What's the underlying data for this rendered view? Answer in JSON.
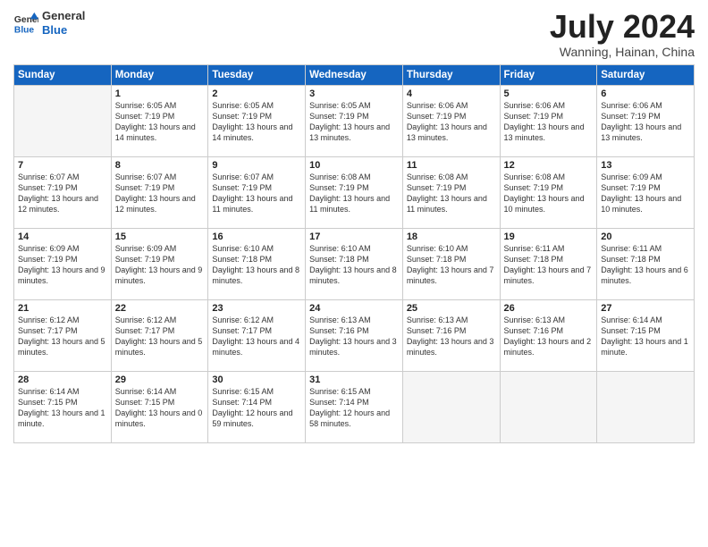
{
  "header": {
    "logo_general": "General",
    "logo_blue": "Blue",
    "month_title": "July 2024",
    "location": "Wanning, Hainan, China"
  },
  "days_of_week": [
    "Sunday",
    "Monday",
    "Tuesday",
    "Wednesday",
    "Thursday",
    "Friday",
    "Saturday"
  ],
  "weeks": [
    [
      {
        "num": "",
        "empty": true
      },
      {
        "num": "1",
        "sunrise": "6:05 AM",
        "sunset": "7:19 PM",
        "daylight": "13 hours and 14 minutes."
      },
      {
        "num": "2",
        "sunrise": "6:05 AM",
        "sunset": "7:19 PM",
        "daylight": "13 hours and 14 minutes."
      },
      {
        "num": "3",
        "sunrise": "6:05 AM",
        "sunset": "7:19 PM",
        "daylight": "13 hours and 13 minutes."
      },
      {
        "num": "4",
        "sunrise": "6:06 AM",
        "sunset": "7:19 PM",
        "daylight": "13 hours and 13 minutes."
      },
      {
        "num": "5",
        "sunrise": "6:06 AM",
        "sunset": "7:19 PM",
        "daylight": "13 hours and 13 minutes."
      },
      {
        "num": "6",
        "sunrise": "6:06 AM",
        "sunset": "7:19 PM",
        "daylight": "13 hours and 13 minutes."
      }
    ],
    [
      {
        "num": "7",
        "sunrise": "6:07 AM",
        "sunset": "7:19 PM",
        "daylight": "13 hours and 12 minutes."
      },
      {
        "num": "8",
        "sunrise": "6:07 AM",
        "sunset": "7:19 PM",
        "daylight": "13 hours and 12 minutes."
      },
      {
        "num": "9",
        "sunrise": "6:07 AM",
        "sunset": "7:19 PM",
        "daylight": "13 hours and 11 minutes."
      },
      {
        "num": "10",
        "sunrise": "6:08 AM",
        "sunset": "7:19 PM",
        "daylight": "13 hours and 11 minutes."
      },
      {
        "num": "11",
        "sunrise": "6:08 AM",
        "sunset": "7:19 PM",
        "daylight": "13 hours and 11 minutes."
      },
      {
        "num": "12",
        "sunrise": "6:08 AM",
        "sunset": "7:19 PM",
        "daylight": "13 hours and 10 minutes."
      },
      {
        "num": "13",
        "sunrise": "6:09 AM",
        "sunset": "7:19 PM",
        "daylight": "13 hours and 10 minutes."
      }
    ],
    [
      {
        "num": "14",
        "sunrise": "6:09 AM",
        "sunset": "7:19 PM",
        "daylight": "13 hours and 9 minutes."
      },
      {
        "num": "15",
        "sunrise": "6:09 AM",
        "sunset": "7:19 PM",
        "daylight": "13 hours and 9 minutes."
      },
      {
        "num": "16",
        "sunrise": "6:10 AM",
        "sunset": "7:18 PM",
        "daylight": "13 hours and 8 minutes."
      },
      {
        "num": "17",
        "sunrise": "6:10 AM",
        "sunset": "7:18 PM",
        "daylight": "13 hours and 8 minutes."
      },
      {
        "num": "18",
        "sunrise": "6:10 AM",
        "sunset": "7:18 PM",
        "daylight": "13 hours and 7 minutes."
      },
      {
        "num": "19",
        "sunrise": "6:11 AM",
        "sunset": "7:18 PM",
        "daylight": "13 hours and 7 minutes."
      },
      {
        "num": "20",
        "sunrise": "6:11 AM",
        "sunset": "7:18 PM",
        "daylight": "13 hours and 6 minutes."
      }
    ],
    [
      {
        "num": "21",
        "sunrise": "6:12 AM",
        "sunset": "7:17 PM",
        "daylight": "13 hours and 5 minutes."
      },
      {
        "num": "22",
        "sunrise": "6:12 AM",
        "sunset": "7:17 PM",
        "daylight": "13 hours and 5 minutes."
      },
      {
        "num": "23",
        "sunrise": "6:12 AM",
        "sunset": "7:17 PM",
        "daylight": "13 hours and 4 minutes."
      },
      {
        "num": "24",
        "sunrise": "6:13 AM",
        "sunset": "7:16 PM",
        "daylight": "13 hours and 3 minutes."
      },
      {
        "num": "25",
        "sunrise": "6:13 AM",
        "sunset": "7:16 PM",
        "daylight": "13 hours and 3 minutes."
      },
      {
        "num": "26",
        "sunrise": "6:13 AM",
        "sunset": "7:16 PM",
        "daylight": "13 hours and 2 minutes."
      },
      {
        "num": "27",
        "sunrise": "6:14 AM",
        "sunset": "7:15 PM",
        "daylight": "13 hours and 1 minute."
      }
    ],
    [
      {
        "num": "28",
        "sunrise": "6:14 AM",
        "sunset": "7:15 PM",
        "daylight": "13 hours and 1 minute."
      },
      {
        "num": "29",
        "sunrise": "6:14 AM",
        "sunset": "7:15 PM",
        "daylight": "13 hours and 0 minutes."
      },
      {
        "num": "30",
        "sunrise": "6:15 AM",
        "sunset": "7:14 PM",
        "daylight": "12 hours and 59 minutes."
      },
      {
        "num": "31",
        "sunrise": "6:15 AM",
        "sunset": "7:14 PM",
        "daylight": "12 hours and 58 minutes."
      },
      {
        "num": "",
        "empty": true
      },
      {
        "num": "",
        "empty": true
      },
      {
        "num": "",
        "empty": true
      }
    ]
  ]
}
